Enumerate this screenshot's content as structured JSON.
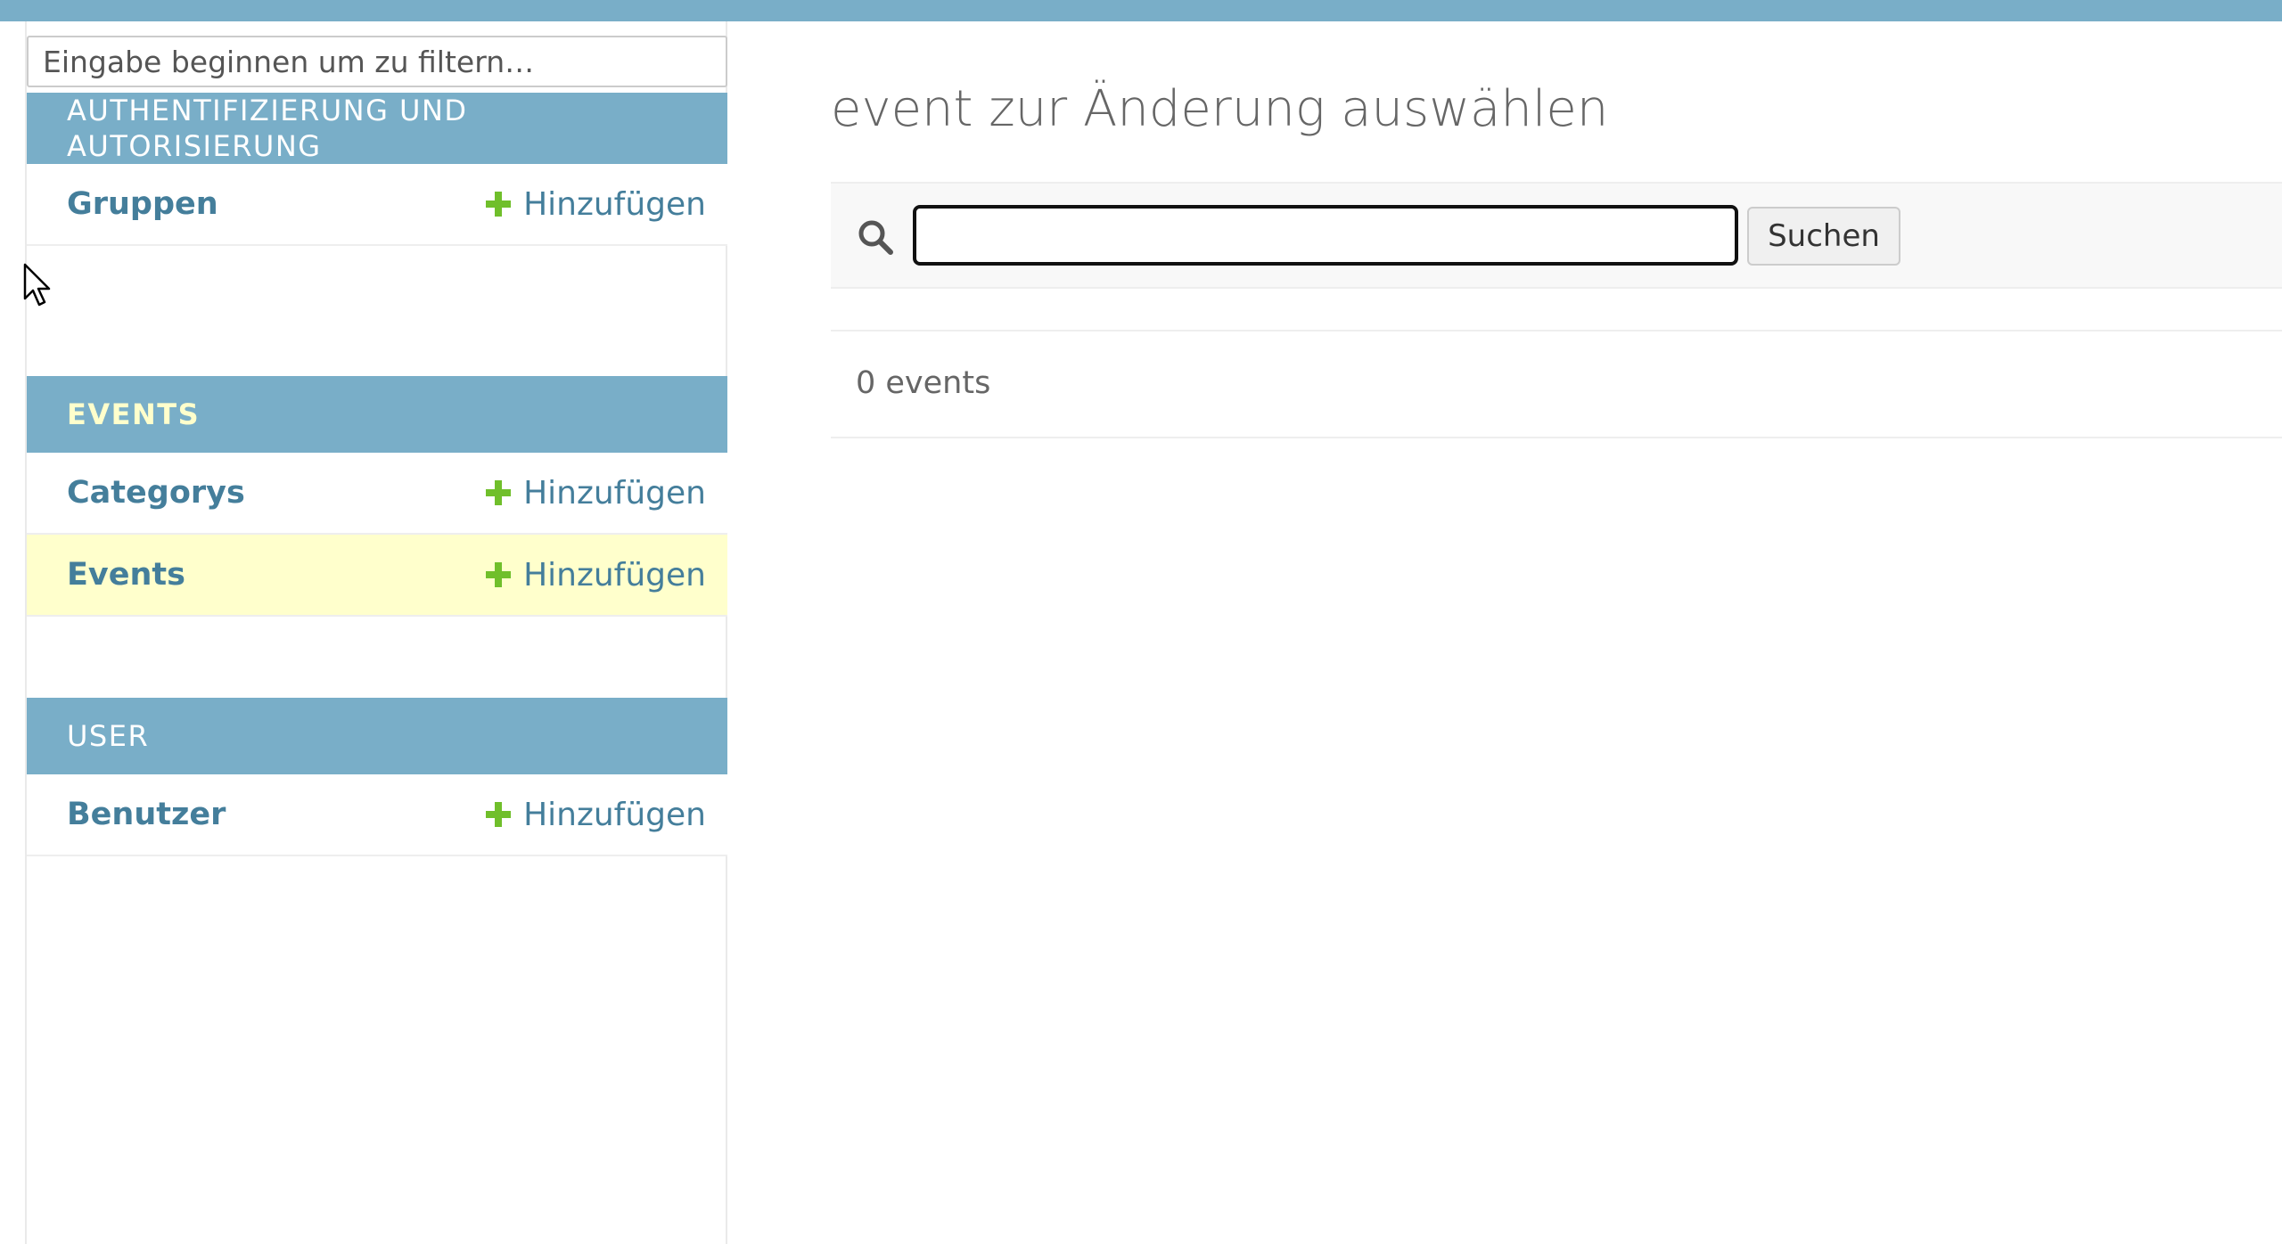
{
  "sidebar": {
    "filter_placeholder": "Eingabe beginnen um zu filtern…",
    "modules": [
      {
        "header": "Authentifizierung und Autorisierung",
        "models": [
          {
            "label": "Gruppen",
            "add_label": "Hinzufügen"
          }
        ]
      },
      {
        "header": "Events",
        "models": [
          {
            "label": "Categorys",
            "add_label": "Hinzufügen"
          },
          {
            "label": "Events",
            "add_label": "Hinzufügen"
          }
        ]
      },
      {
        "header": "User",
        "models": [
          {
            "label": "Benutzer",
            "add_label": "Hinzufügen"
          }
        ]
      }
    ]
  },
  "main": {
    "title": "event zur Änderung auswählen",
    "search": {
      "value": "",
      "button_label": "Suchen"
    },
    "result_count": "0 events"
  },
  "colors": {
    "header_bg": "#79aec8",
    "link": "#447e9b",
    "add_icon": "#70bf2b",
    "current_row_bg": "#ffffcc"
  },
  "icons": [
    "search-icon",
    "plus-icon",
    "cursor-icon"
  ]
}
